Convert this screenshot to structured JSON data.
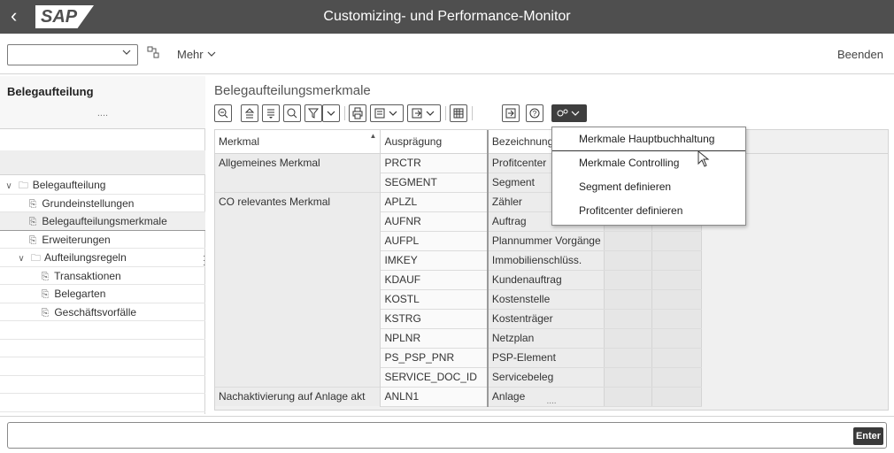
{
  "window": {
    "back_glyph": "‹",
    "logo": "SAP",
    "title": "Customizing- und Performance-Monitor"
  },
  "toolbar": {
    "combo_value": "",
    "more_label": "Mehr",
    "exit_label": "Beenden"
  },
  "left": {
    "title": "Belegaufteilung",
    "dots": "....",
    "tree": [
      {
        "label": "Belegaufteilung",
        "level": 0,
        "icon": "folder-icon",
        "expanded": true
      },
      {
        "label": "Grundeinstellungen",
        "level": 1,
        "icon": "doc-icon"
      },
      {
        "label": "Belegaufteilungsmerkmale",
        "level": 1,
        "icon": "doc-icon",
        "selected": true
      },
      {
        "label": "Erweiterungen",
        "level": 1,
        "icon": "doc-icon"
      },
      {
        "label": "Aufteilungsregeln",
        "level": 0,
        "icon": "folder-icon",
        "expanded": true
      },
      {
        "label": "Transaktionen",
        "level": 2,
        "icon": "doc-icon"
      },
      {
        "label": "Belegarten",
        "level": 2,
        "icon": "doc-icon"
      },
      {
        "label": "Geschäftsvorfälle",
        "level": 2,
        "icon": "doc-icon"
      }
    ]
  },
  "main": {
    "section_title": "Belegaufteilungsmerkmale",
    "columns": [
      "Merkmal",
      "Ausprägung",
      "Bezeichnung"
    ],
    "rows": [
      {
        "merkmal": "Allgemeines Merkmal",
        "auspraegung": "PRCTR",
        "bezeichnung": "Profitcenter"
      },
      {
        "merkmal": "",
        "auspraegung": "SEGMENT",
        "bezeichnung": "Segment"
      },
      {
        "merkmal": "CO relevantes Merkmal",
        "auspraegung": "APLZL",
        "bezeichnung": "Zähler"
      },
      {
        "merkmal": "",
        "auspraegung": "AUFNR",
        "bezeichnung": "Auftrag"
      },
      {
        "merkmal": "",
        "auspraegung": "AUFPL",
        "bezeichnung": "Plannummer Vorgänge"
      },
      {
        "merkmal": "",
        "auspraegung": "IMKEY",
        "bezeichnung": "Immobilienschlüss."
      },
      {
        "merkmal": "",
        "auspraegung": "KDAUF",
        "bezeichnung": "Kundenauftrag"
      },
      {
        "merkmal": "",
        "auspraegung": "KOSTL",
        "bezeichnung": "Kostenstelle"
      },
      {
        "merkmal": "",
        "auspraegung": "KSTRG",
        "bezeichnung": "Kostenträger"
      },
      {
        "merkmal": "",
        "auspraegung": "NPLNR",
        "bezeichnung": "Netzplan"
      },
      {
        "merkmal": "",
        "auspraegung": "PS_PSP_PNR",
        "bezeichnung": "PSP-Element"
      },
      {
        "merkmal": "",
        "auspraegung": "SERVICE_DOC_ID",
        "bezeichnung": "Servicebeleg"
      },
      {
        "merkmal": "Nachaktivierung auf Anlage akt",
        "auspraegung": "ANLN1",
        "bezeichnung": "Anlage"
      }
    ],
    "grid_dots": "...."
  },
  "menu": {
    "items": [
      {
        "label": "Merkmale Hauptbuchhaltung",
        "mnemonic": "M"
      },
      {
        "label": "Merkmale Controlling",
        "mnemonic": "M"
      },
      {
        "label": "Segment definieren",
        "mnemonic": "S"
      },
      {
        "label": "Profitcenter definieren",
        "mnemonic": "P"
      }
    ]
  },
  "cmdbar": {
    "value": "",
    "enter_label": "Enter"
  },
  "colors": {
    "titlebar": "#4f4f4f",
    "accent_dark": "#3e3e3e"
  }
}
